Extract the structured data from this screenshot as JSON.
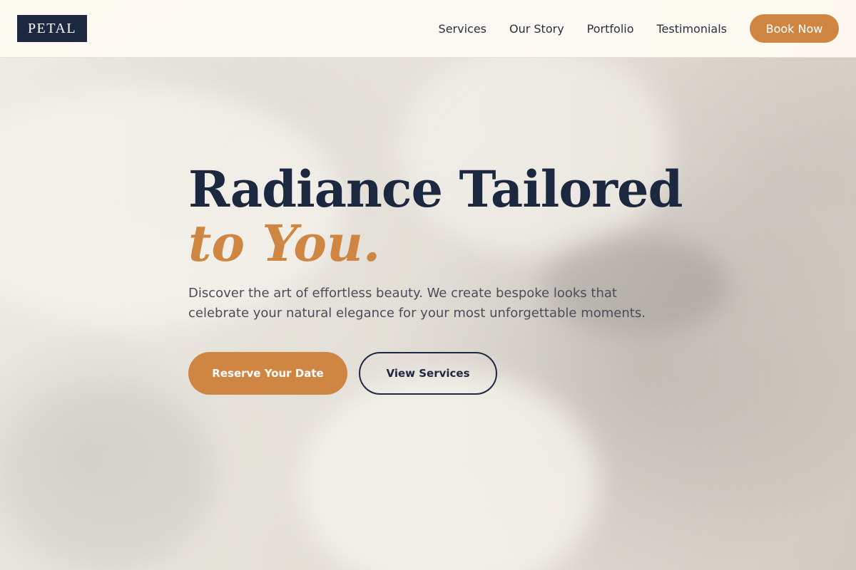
{
  "brand": {
    "logo_text": "PETAL"
  },
  "nav": {
    "links": [
      "Services",
      "Our Story",
      "Portfolio",
      "Testimonials"
    ],
    "cta_label": "Book Now"
  },
  "hero": {
    "headline_line1": "Radiance Tailored",
    "headline_line2": "to You.",
    "subtext": "Discover the art of effortless beauty. We create bespoke looks that celebrate your natural elegance for your most unforgettable moments.",
    "primary_cta": "Reserve Your Date",
    "secondary_cta": "View Services",
    "background_image": "makeup-application-photo"
  },
  "colors": {
    "navy": "#1c2840",
    "accent": "#cf8642",
    "nav_bg": "#fdfaf3",
    "body_text": "#4a4d57"
  }
}
